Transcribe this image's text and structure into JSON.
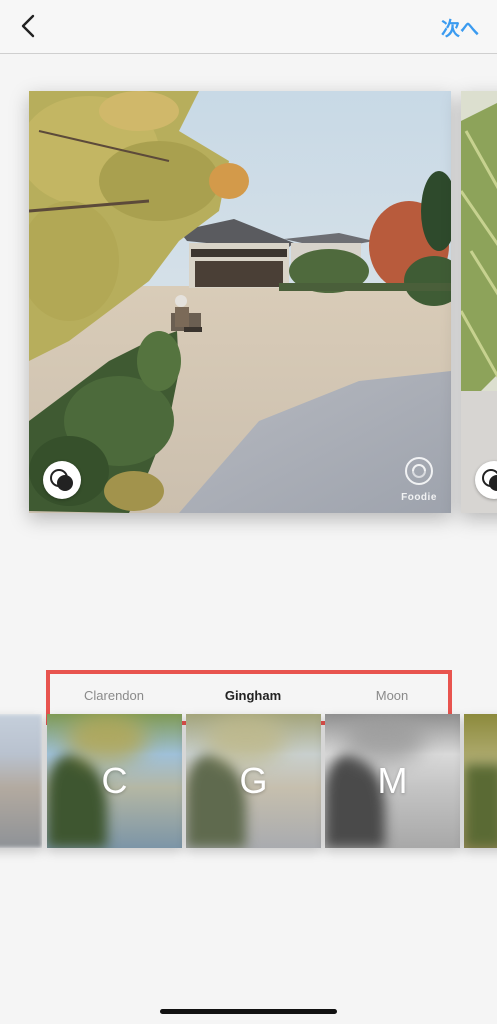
{
  "nav": {
    "next_label": "次へ"
  },
  "photo": {
    "watermark": "Foodie"
  },
  "filters": [
    {
      "name": "Clarendon",
      "letter": "C",
      "active": false
    },
    {
      "name": "Gingham",
      "letter": "G",
      "active": true
    },
    {
      "name": "Moon",
      "letter": "M",
      "active": false
    }
  ],
  "colors": {
    "accent": "#3b9bf0",
    "highlight": "#e8544f",
    "background": "#f5f5f5"
  }
}
